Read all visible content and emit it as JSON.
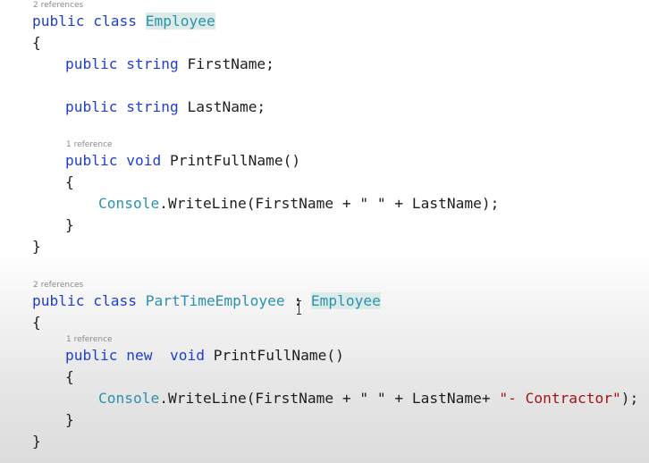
{
  "code": {
    "class1": {
      "lens": "2 references",
      "kw_public": "public",
      "kw_class": "class",
      "name": "Employee",
      "open_brace": "{",
      "field1": {
        "kw_public": "public",
        "kw_type": "string",
        "name": "FirstName;"
      },
      "field2": {
        "kw_public": "public",
        "kw_type": "string",
        "name": "LastName;"
      },
      "method": {
        "lens": "1 reference",
        "kw_public": "public",
        "kw_void": "void",
        "name": "PrintFullName()",
        "open_brace": "{",
        "body": {
          "type": "Console",
          "call": ".WriteLine(FirstName + ",
          "str": "\" \"",
          "rest": " + LastName);"
        },
        "close_brace": "}"
      },
      "close_brace": "}"
    },
    "class2": {
      "lens": "2 references",
      "kw_public": "public",
      "kw_class": "class",
      "name": "PartTimeEmployee",
      "colon": " : ",
      "base": "Employee",
      "open_brace": "{",
      "method": {
        "lens": "1 reference",
        "kw_public": "public",
        "kw_new": "new",
        "kw_void": "void",
        "name": "PrintFullName()",
        "open_brace": "{",
        "body": {
          "type": "Console",
          "call": ".WriteLine(FirstName + ",
          "str1": "\" \"",
          "mid": " + LastName+ ",
          "str2": "\"- Contractor\"",
          "rest": ");"
        },
        "close_brace": "}"
      },
      "close_brace": "}"
    }
  },
  "colors": {
    "keyword": "#1f3fd0",
    "type": "#2b91af",
    "string": "#a31515",
    "text": "#1e1e1e",
    "lens": "#8a8a8a",
    "highlight": "#dcebe7"
  },
  "cursor": "text-ibeam-cursor"
}
